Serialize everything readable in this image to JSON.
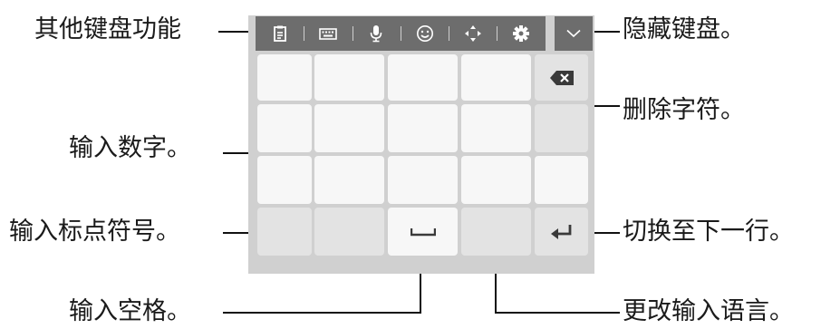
{
  "callouts": {
    "other_functions": "其他键盘功能",
    "hide_keyboard": "隐藏键盘。",
    "delete_char": "删除字符。",
    "enter_numbers": "输入数字。",
    "enter_symbols": "输入标点符号。",
    "new_line": "切换至下一行。",
    "enter_space": "输入空格。",
    "change_language": "更改输入语言。"
  },
  "toolbar_icons": [
    "clipboard-icon",
    "keyboard-icon",
    "microphone-icon",
    "emoji-icon",
    "cursor-move-icon",
    "settings-gear-icon"
  ],
  "hide_icon": "chevron-down-icon",
  "colors": {
    "toolbar": "#6d6d6d",
    "keyboard_bg": "#d0d0d0",
    "key": "#f7f7f7",
    "key_function": "#e3e3e3",
    "icon": "#ffffff",
    "key_icon": "#444444"
  }
}
